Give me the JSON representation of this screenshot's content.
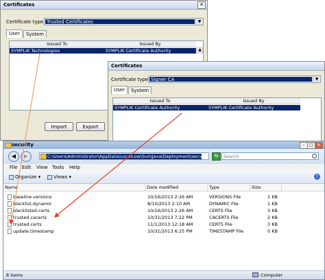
{
  "win1": {
    "title": "Certificates",
    "cert_type_label": "Certificate type:",
    "cert_type_value": "Trusted Certificates",
    "tabs": [
      "User",
      "System"
    ],
    "columns": [
      "Issued To",
      "Issued By"
    ],
    "row": {
      "issued_to": "SYMPLIK Technologies",
      "issued_by": "SYMPLIK Certificate Authority"
    },
    "buttons": {
      "import": "Import",
      "export": "Export"
    }
  },
  "win2": {
    "title": "Certificates",
    "cert_type_label": "Certificate type:",
    "cert_type_value": "Signer CA",
    "tabs": [
      "User",
      "System"
    ],
    "columns": [
      "Issued To",
      "Issued By"
    ],
    "row": {
      "issued_to": "SYMPLIK Certificate Authority",
      "issued_by": "SYMPLIK Certificate Authority"
    }
  },
  "explorer": {
    "title": "security",
    "address": "C:\\Users\\Administrator\\AppData\\LocalLow\\Sun\\Java\\Deployment\\security",
    "search_placeholder": "Search",
    "menu": [
      "File",
      "Edit",
      "View",
      "Tools",
      "Help"
    ],
    "toolbar": {
      "organize": "Organize",
      "views": "Views"
    },
    "columns": {
      "name": "Name",
      "date": "Date modified",
      "type": "Type",
      "size": "Size"
    },
    "files": [
      {
        "name": "baseline.versions",
        "date": "10/16/2013 2:26 AM",
        "type": "VERSIONS File",
        "size": "1 KB"
      },
      {
        "name": "blacklist.dynamic",
        "date": "8/10/2013 2:10 AM",
        "type": "DYNAMIC File",
        "size": "1 KB"
      },
      {
        "name": "blacklisted.certs",
        "date": "10/16/2013 2:26 AM",
        "type": "CERTS File",
        "size": "3 KB"
      },
      {
        "name": "trusted.cacerts",
        "date": "10/31/2013 7:22 PM",
        "type": "CACERTS File",
        "size": "2 KB"
      },
      {
        "name": "trusted.certs",
        "date": "11/1/2013 12:18 AM",
        "type": "CERTS File",
        "size": "3 KB"
      },
      {
        "name": "update.timestamp",
        "date": "10/31/2013 6:25 PM",
        "type": "TIMESTAMP File",
        "size": "0 KB"
      }
    ],
    "status_items": "8 items",
    "status_location": "Computer"
  },
  "colors": {
    "selection": "#0a246a",
    "arrow": "#e8391f"
  }
}
